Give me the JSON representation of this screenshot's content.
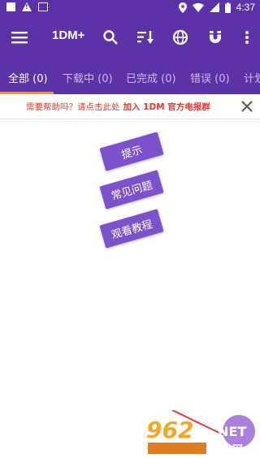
{
  "status_bar": {
    "time": "4:37"
  },
  "app_bar": {
    "title": "1DM+"
  },
  "tabs": [
    {
      "label": "全部 (0)",
      "active": true
    },
    {
      "label": "下载中 (0)",
      "active": false
    },
    {
      "label": "已完成 (0)",
      "active": false
    },
    {
      "label": "错误 (0)",
      "active": false
    },
    {
      "label": "计划",
      "active": false
    }
  ],
  "help_banner": {
    "text": "需要帮助吗？请点击此处",
    "link_text": "加入 1DM 官方电报群"
  },
  "cards": [
    {
      "label": "提示"
    },
    {
      "label": "常见问题"
    },
    {
      "label": "观看教程"
    }
  ],
  "watermark": {
    "number": "962",
    "suffix": ".NET",
    "cn": "乐游网"
  },
  "colors": {
    "primary": "#5b33a7",
    "card": "#7c52cc",
    "indicator": "#ff9800",
    "banner_text": "#e53935"
  }
}
